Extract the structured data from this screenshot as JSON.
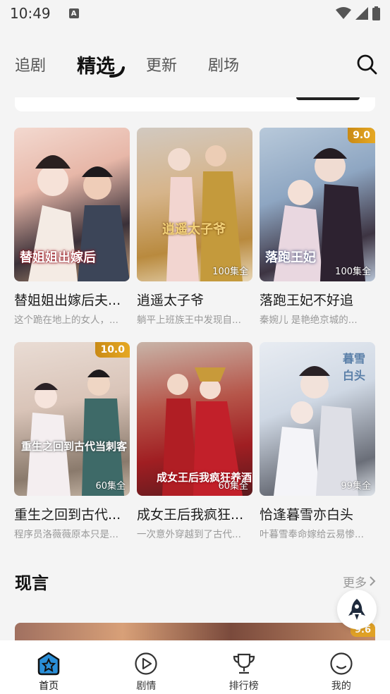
{
  "status_bar": {
    "time": "10:49",
    "notif_letter": "A"
  },
  "top_tabs": [
    {
      "label": "追剧",
      "active": false
    },
    {
      "label": "精选",
      "active": true
    },
    {
      "label": "更新",
      "active": false
    },
    {
      "label": "剧场",
      "active": false
    }
  ],
  "dramas": [
    {
      "title": "替姐姐出嫁后夫...",
      "desc": "这个跪在地上的女人，...",
      "poster_text": "替姐姐出嫁后",
      "episodes": "",
      "score": ""
    },
    {
      "title": "逍遥太子爷",
      "desc": "躺平上班族王中发现自...",
      "poster_text": "逍遥太子爷",
      "episodes": "100集全",
      "score": ""
    },
    {
      "title": "落跑王妃不好追",
      "desc": "秦婉儿 是艳绝京城的...",
      "poster_text": "落跑王妃",
      "episodes": "100集全",
      "score": "9.0"
    },
    {
      "title": "重生之回到古代...",
      "desc": "程序员洛薇薇原本只是...",
      "poster_text": "重生之回到古代当刺客",
      "episodes": "60集全",
      "score": "10.0"
    },
    {
      "title": "成女王后我疯狂...",
      "desc": "一次意外穿越到了古代...",
      "poster_text": "成女王后我疯狂养酒",
      "episodes": "60集全",
      "score": ""
    },
    {
      "title": "恰逢暮雪亦白头",
      "desc": "叶暮雪奉命嫁给云易惨...",
      "poster_text": "暮雪白头",
      "episodes": "99集全",
      "score": ""
    }
  ],
  "section": {
    "title": "现言",
    "more": "更多"
  },
  "next_card": {
    "score": "9.6"
  },
  "bottom_nav": [
    {
      "label": "首页",
      "icon": "home-star-icon",
      "active": true
    },
    {
      "label": "剧情",
      "icon": "play-circle-icon",
      "active": false
    },
    {
      "label": "排行榜",
      "icon": "trophy-icon",
      "active": false
    },
    {
      "label": "我的",
      "icon": "profile-icon",
      "active": false
    }
  ],
  "colors": {
    "accent": "#e0a125",
    "text": "#1c1c1c",
    "muted": "#999999",
    "background": "#f4f4f4"
  }
}
